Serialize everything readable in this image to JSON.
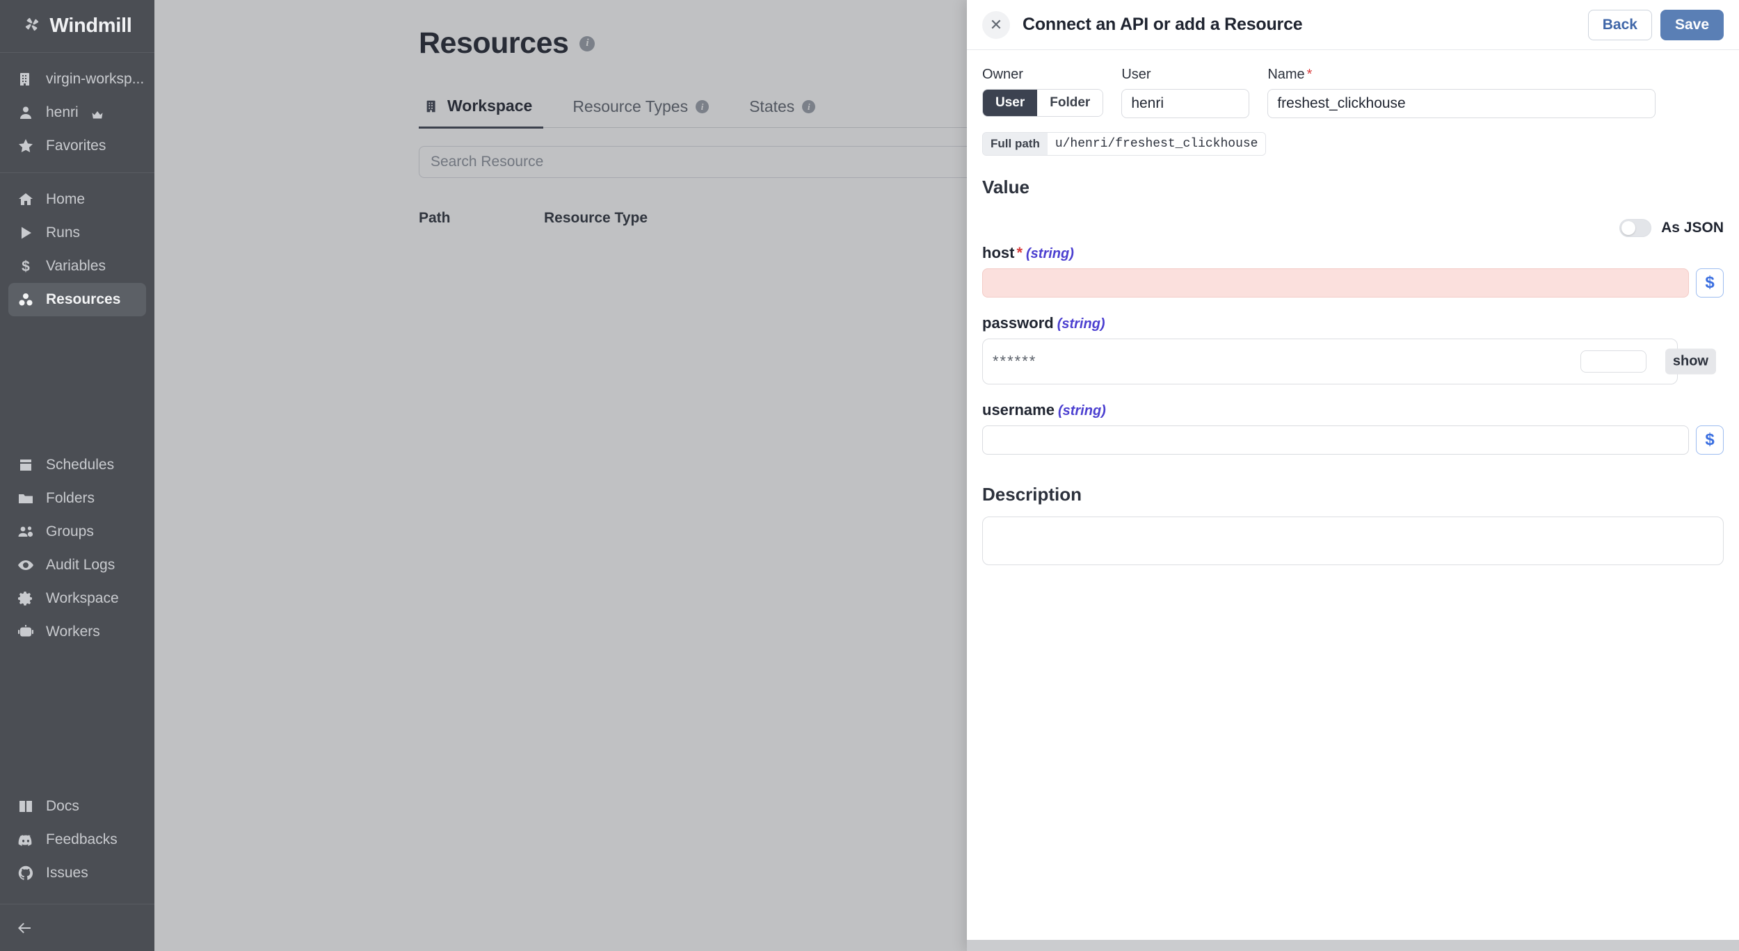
{
  "app": {
    "brand": "Windmill",
    "brand_icon": "windmill-pinwheel-icon"
  },
  "sidebar": {
    "workspace": {
      "label": "virgin-worksp...",
      "icon": "building-icon"
    },
    "user": {
      "label": "henri",
      "icon": "user-icon",
      "badge_icon": "crown-icon"
    },
    "favorites": {
      "label": "Favorites",
      "icon": "star-icon"
    },
    "nav_primary": [
      {
        "label": "Home",
        "icon": "home-icon",
        "active": false
      },
      {
        "label": "Runs",
        "icon": "play-icon",
        "active": false
      },
      {
        "label": "Variables",
        "icon": "dollar-icon",
        "active": false
      },
      {
        "label": "Resources",
        "icon": "resources-icon",
        "active": true
      }
    ],
    "nav_secondary": [
      {
        "label": "Schedules",
        "icon": "calendar-icon"
      },
      {
        "label": "Folders",
        "icon": "folder-icon"
      },
      {
        "label": "Groups",
        "icon": "groups-icon"
      },
      {
        "label": "Audit Logs",
        "icon": "eye-icon"
      },
      {
        "label": "Workspace",
        "icon": "gear-icon"
      },
      {
        "label": "Workers",
        "icon": "robot-icon"
      }
    ],
    "nav_footer": [
      {
        "label": "Docs",
        "icon": "book-icon"
      },
      {
        "label": "Feedbacks",
        "icon": "discord-icon"
      },
      {
        "label": "Issues",
        "icon": "github-icon"
      }
    ],
    "collapse": {
      "icon": "arrow-left-icon"
    }
  },
  "main": {
    "page_title": "Resources",
    "page_title_info_icon": "info-icon",
    "tabs": [
      {
        "label": "Workspace",
        "icon": "building-icon",
        "active": true,
        "info": false
      },
      {
        "label": "Resource Types",
        "active": false,
        "info": true
      },
      {
        "label": "States",
        "active": false,
        "info": true
      }
    ],
    "search": {
      "placeholder": "Search Resource",
      "value": ""
    },
    "table_headers": [
      "Path",
      "Resource Type"
    ]
  },
  "drawer": {
    "title": "Connect an API or add a Resource",
    "close_icon": "close-icon",
    "back_label": "Back",
    "save_label": "Save",
    "owner": {
      "label": "Owner",
      "options": [
        "User",
        "Folder"
      ],
      "selected": "User"
    },
    "user": {
      "label": "User",
      "value": "henri"
    },
    "name": {
      "label": "Name",
      "required": true,
      "value": "freshest_clickhouse"
    },
    "full_path": {
      "label": "Full path",
      "value": "u/henri/freshest_clickhouse"
    },
    "value_section": {
      "title": "Value"
    },
    "as_json": {
      "label": "As JSON",
      "enabled": false
    },
    "fields": [
      {
        "name": "host",
        "type": "(string)",
        "required": true,
        "value": "",
        "error": true,
        "action_icon": "dollar-icon"
      },
      {
        "name": "password",
        "type": "(string)",
        "required": false,
        "value": "******",
        "show_label": "show"
      },
      {
        "name": "username",
        "type": "(string)",
        "required": false,
        "value": "",
        "action_icon": "dollar-icon"
      }
    ],
    "description": {
      "title": "Description",
      "value": ""
    }
  },
  "colors": {
    "sidebar_bg": "#4b4e54",
    "accent_save": "#5a7fb5",
    "accent_link": "#3f66a8",
    "error_bg": "#fbe0dd",
    "type_text": "#4b3fd0",
    "required_star": "#d83c3c"
  }
}
